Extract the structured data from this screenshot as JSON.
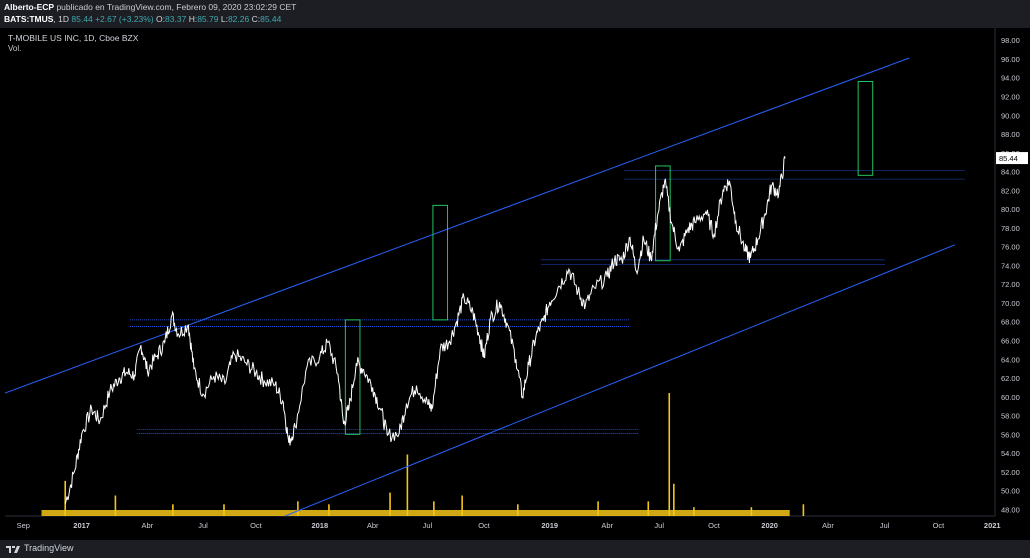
{
  "header": {
    "publisher": "Alberto-ECP",
    "published_text": "publicado en TradingView.com, Febrero 09, 2020 23:02:29 CET",
    "symbol": "BATS:TMUS",
    "interval": "1D",
    "last": "85.44",
    "change": "+2.67 (+3.23%)",
    "o_label": "O:",
    "o_value": "83.37",
    "h_label": "H:",
    "h_value": "85.79",
    "l_label": "L:",
    "l_value": "82.26",
    "c_label": "C:",
    "c_value": "85.44"
  },
  "legend": {
    "title": "T-MOBILE US INC, 1D, Cboe BZX",
    "vol": "Vol."
  },
  "footer": {
    "brand": "TradingView"
  },
  "colors": {
    "background": "#000000",
    "price_line": "#ffffff",
    "channel": "#2962ff",
    "box": "#22c55e",
    "volume": "#f5c518",
    "axis_text": "#c8cbd2",
    "last_price_bg": "#ffffff"
  },
  "chart_data": {
    "type": "line",
    "title": "T-MOBILE US INC, 1D, Cboe BZX",
    "xlabel": "",
    "ylabel": "",
    "ylim": [
      47.3,
      99.3
    ],
    "x_ticks": [
      "Sep",
      "2017",
      "Abr",
      "Jul",
      "Oct",
      "2018",
      "Abr",
      "Jul",
      "Oct",
      "2019",
      "Abr",
      "Jul",
      "Oct",
      "2020",
      "Abr",
      "Jul",
      "Oct",
      "2021"
    ],
    "x_ticks_t": [
      0,
      6.4,
      13.6,
      19.7,
      25.5,
      32.5,
      38.3,
      44.3,
      50.5,
      57.7,
      64.0,
      69.7,
      75.7,
      81.8,
      88.2,
      94.4,
      100.3,
      106.2
    ],
    "y_ticks": [
      "48.00",
      "50.00",
      "52.00",
      "54.00",
      "56.00",
      "58.00",
      "60.00",
      "62.00",
      "64.00",
      "66.00",
      "68.00",
      "70.00",
      "72.00",
      "74.00",
      "76.00",
      "78.00",
      "80.00",
      "82.00",
      "84.00",
      "86.00",
      "88.00",
      "90.00",
      "92.00",
      "94.00",
      "96.00",
      "98.00"
    ],
    "last_price_label": "85.44",
    "series": [
      {
        "values_xy": [
          [
            4.6,
            48.6
          ],
          [
            5.6,
            52
          ],
          [
            6.4,
            56
          ],
          [
            7.5,
            58.7
          ],
          [
            8.4,
            57.4
          ],
          [
            9.5,
            60.6
          ],
          [
            10.5,
            62
          ],
          [
            11.3,
            62.6
          ],
          [
            12.2,
            62.3
          ],
          [
            12.9,
            65.5
          ],
          [
            13.6,
            62.8
          ],
          [
            14.6,
            64.3
          ],
          [
            15.5,
            65.8
          ],
          [
            16.3,
            68.7
          ],
          [
            17.0,
            66.7
          ],
          [
            18.1,
            67.7
          ],
          [
            18.7,
            63
          ],
          [
            19.7,
            60.3
          ],
          [
            20.9,
            62.2
          ],
          [
            22.1,
            61.4
          ],
          [
            23.1,
            64.6
          ],
          [
            24.4,
            63.6
          ],
          [
            25.5,
            62.6
          ],
          [
            26.4,
            61.7
          ],
          [
            27.6,
            61.3
          ],
          [
            28.5,
            59.4
          ],
          [
            29.1,
            55.1
          ],
          [
            29.8,
            56.8
          ],
          [
            31.1,
            63.2
          ],
          [
            32.5,
            64.3
          ],
          [
            33.4,
            65.8
          ],
          [
            34.5,
            62.4
          ],
          [
            35.1,
            57.1
          ],
          [
            35.7,
            58.8
          ],
          [
            36.5,
            63.6
          ],
          [
            37.3,
            62.9
          ],
          [
            38.3,
            61
          ],
          [
            39.2,
            58.6
          ],
          [
            39.9,
            55.9
          ],
          [
            41.2,
            56.1
          ],
          [
            42.0,
            59.3
          ],
          [
            43.1,
            61.2
          ],
          [
            44.3,
            59.3
          ],
          [
            44.8,
            58.7
          ],
          [
            45.7,
            65.1
          ],
          [
            46.7,
            65.9
          ],
          [
            47.5,
            68
          ],
          [
            48.3,
            70.6
          ],
          [
            49.3,
            68.9
          ],
          [
            50.0,
            66.5
          ],
          [
            50.5,
            64.2
          ],
          [
            51.2,
            68.3
          ],
          [
            52.2,
            70.1
          ],
          [
            53.0,
            67.9
          ],
          [
            54.0,
            64
          ],
          [
            54.7,
            60
          ],
          [
            55.4,
            63.4
          ],
          [
            56.2,
            66.5
          ],
          [
            57.0,
            68.1
          ],
          [
            57.7,
            70.1
          ],
          [
            58.7,
            71.8
          ],
          [
            59.8,
            73.6
          ],
          [
            60.8,
            71.2
          ],
          [
            61.6,
            69.7
          ],
          [
            62.6,
            71.6
          ],
          [
            64.0,
            72.8
          ],
          [
            64.8,
            74.6
          ],
          [
            65.6,
            74.6
          ],
          [
            66.5,
            77
          ],
          [
            67.2,
            73.4
          ],
          [
            68.0,
            76.8
          ],
          [
            68.8,
            74.7
          ],
          [
            69.5,
            79.2
          ],
          [
            70.3,
            83
          ],
          [
            71.1,
            78.4
          ],
          [
            71.9,
            75.5
          ],
          [
            72.8,
            77.8
          ],
          [
            73.6,
            78.6
          ],
          [
            74.8,
            79.7
          ],
          [
            75.7,
            77.3
          ],
          [
            76.7,
            82.1
          ],
          [
            77.4,
            83
          ],
          [
            78.1,
            78.7
          ],
          [
            79.1,
            75.6
          ],
          [
            79.7,
            74.8
          ],
          [
            80.5,
            76.8
          ],
          [
            81.3,
            79.5
          ],
          [
            82.0,
            82.5
          ],
          [
            82.8,
            81.7
          ],
          [
            83.5,
            85.4
          ]
        ]
      },
      {
        "name": "",
        "values_xy": []
      }
    ],
    "volume_spikes": [
      [
        4.6,
        0.12
      ],
      [
        10.1,
        0.07
      ],
      [
        16.4,
        0.04
      ],
      [
        22.0,
        0.04
      ],
      [
        30.1,
        0.05
      ],
      [
        33.5,
        0.04
      ],
      [
        40.2,
        0.08
      ],
      [
        42.1,
        0.21
      ],
      [
        45.0,
        0.05
      ],
      [
        48.1,
        0.07
      ],
      [
        54.2,
        0.04
      ],
      [
        63.0,
        0.05
      ],
      [
        68.5,
        0.05
      ],
      [
        70.8,
        0.42
      ],
      [
        71.3,
        0.11
      ],
      [
        73.5,
        0.03
      ],
      [
        79.8,
        0.03
      ],
      [
        85.5,
        0.04
      ]
    ],
    "channel_lines": [
      {
        "x1": -2.0,
        "y1": 60.4,
        "x2": 97.1,
        "y2": 96.1
      },
      {
        "x1": 28.7,
        "y1": 47.3,
        "x2": 102.1,
        "y2": 76.2
      }
    ],
    "horizontal_zones": [
      {
        "x1": 11.7,
        "x2": 66.5,
        "y1": 67.5,
        "y2": 68.2
      },
      {
        "x1": 12.5,
        "x2": 67.4,
        "y1": 56.1,
        "y2": 56.5
      },
      {
        "x1": 56.8,
        "x2": 94.5,
        "y1": 74.1,
        "y2": 74.6
      },
      {
        "x1": 65.9,
        "x2": 103.2,
        "y1": 83.2,
        "y2": 84.1
      }
    ],
    "boxes": [
      {
        "x": 35.3,
        "w": 1.6,
        "y1": 56.0,
        "y2": 68.2
      },
      {
        "x": 44.9,
        "w": 1.6,
        "y1": 68.2,
        "y2": 80.4
      },
      {
        "x": 69.3,
        "w": 1.6,
        "y1": 74.5,
        "y2": 84.6
      },
      {
        "x": 91.5,
        "w": 1.6,
        "y1": 83.6,
        "y2": 93.6
      }
    ],
    "grid": false
  }
}
